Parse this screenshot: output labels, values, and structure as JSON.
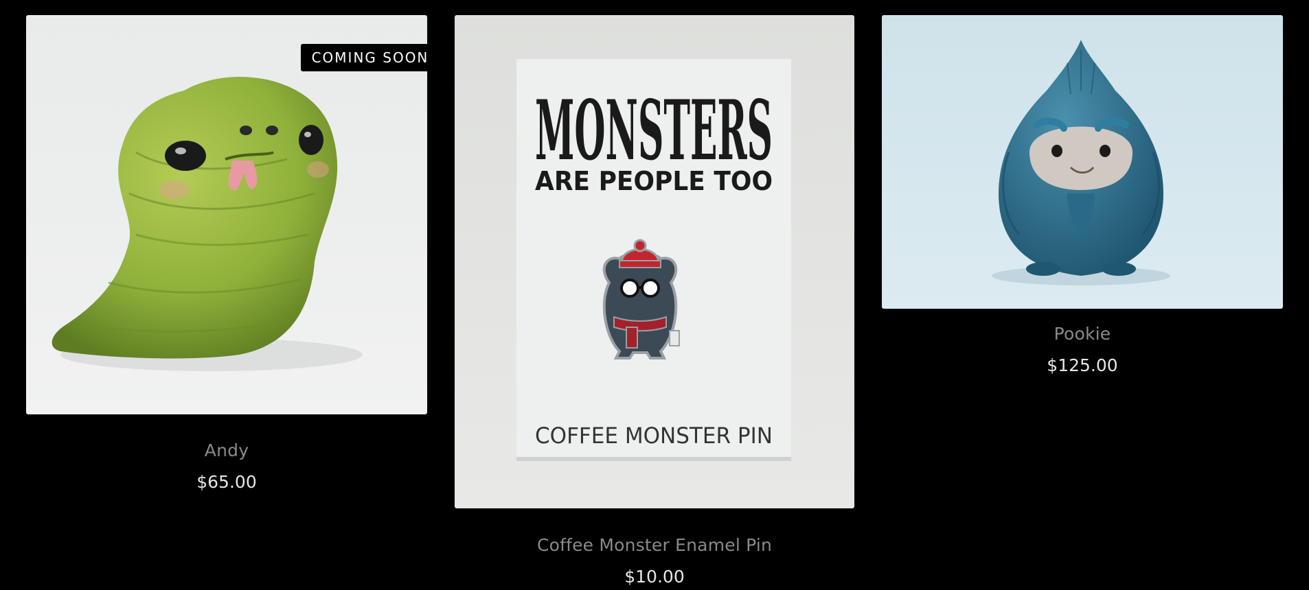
{
  "products": [
    {
      "title": "Andy",
      "price": "$65.00",
      "badge": "COMING SOON",
      "image": "green-slug-monster-figurine"
    },
    {
      "title": "Coffee Monster Enamel Pin",
      "price": "$10.00",
      "image": "coffee-monster-enamel-pin-card",
      "card_text": {
        "headline": "MONSTERS",
        "tagline": "ARE PEOPLE TOO",
        "caption": "COFFEE MONSTER PIN"
      }
    },
    {
      "title": "Pookie",
      "price": "$125.00",
      "image": "blue-furry-monster-figurine"
    }
  ],
  "colors": {
    "background": "#000000",
    "title": "#8a8a8a",
    "price": "#e6e6e6",
    "badge_bg": "#000000",
    "badge_text": "#ffffff"
  }
}
